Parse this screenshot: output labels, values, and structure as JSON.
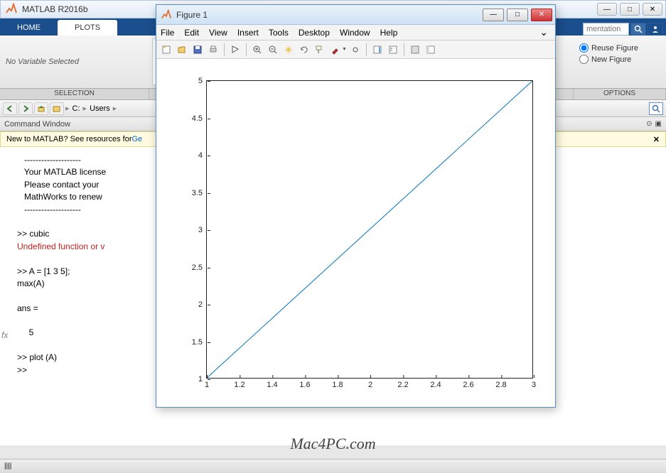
{
  "main_window": {
    "title": "MATLAB R2016b",
    "win_buttons": {
      "min": "—",
      "max": "□",
      "close": "✕"
    }
  },
  "ribbon": {
    "tabs": [
      "HOME",
      "PLOTS"
    ],
    "active_tab": 1,
    "search_placeholder": "mentation",
    "selection_text": "No Variable Selected",
    "options": {
      "reuse": "Reuse Figure",
      "newf": "New Figure"
    },
    "sections": {
      "selection": "SELECTION",
      "options": "OPTIONS"
    }
  },
  "pathbar": {
    "segments": [
      "C:",
      "Users"
    ]
  },
  "cmdwin": {
    "title": "Command Window",
    "banner_pre": "New to MATLAB? See resources for ",
    "banner_link": "Ge",
    "lines": [
      {
        "cls": "",
        "t": "   --------------------"
      },
      {
        "cls": "",
        "t": "   Your MATLAB license"
      },
      {
        "cls": "",
        "t": "   Please contact your"
      },
      {
        "cls": "",
        "t": "   MathWorks to renew "
      },
      {
        "cls": "",
        "t": "   --------------------"
      },
      {
        "cls": "",
        "t": " "
      },
      {
        "cls": "",
        "t": ">> cubic"
      },
      {
        "cls": "err",
        "t": "Undefined function or v"
      },
      {
        "cls": "",
        "t": " "
      },
      {
        "cls": "",
        "t": ">> A = [1 3 5];"
      },
      {
        "cls": "",
        "t": "max(A)"
      },
      {
        "cls": "",
        "t": " "
      },
      {
        "cls": "",
        "t": "ans ="
      },
      {
        "cls": "",
        "t": " "
      },
      {
        "cls": "",
        "t": "     5"
      },
      {
        "cls": "",
        "t": " "
      },
      {
        "cls": "",
        "t": ">> plot (A)"
      },
      {
        "cls": "",
        "t": ">> "
      }
    ],
    "fx_label": "fx"
  },
  "figure": {
    "title": "Figure 1",
    "menus": [
      "File",
      "Edit",
      "View",
      "Insert",
      "Tools",
      "Desktop",
      "Window",
      "Help"
    ],
    "dock_arrow": "⌄",
    "win_buttons": {
      "min": "—",
      "max": "□",
      "close": "✕"
    }
  },
  "chart_data": {
    "type": "line",
    "x": [
      1,
      2,
      3
    ],
    "y": [
      1,
      3,
      5
    ],
    "xlim": [
      1,
      3
    ],
    "ylim": [
      1,
      5
    ],
    "xticks": [
      1,
      1.2,
      1.4,
      1.6,
      1.8,
      2,
      2.2,
      2.4,
      2.6,
      2.8,
      3
    ],
    "yticks": [
      1,
      1.5,
      2,
      2.5,
      3,
      3.5,
      4,
      4.5,
      5
    ],
    "title": "",
    "xlabel": "",
    "ylabel": ""
  },
  "watermark": "Mac4PC.com",
  "status": "||||"
}
